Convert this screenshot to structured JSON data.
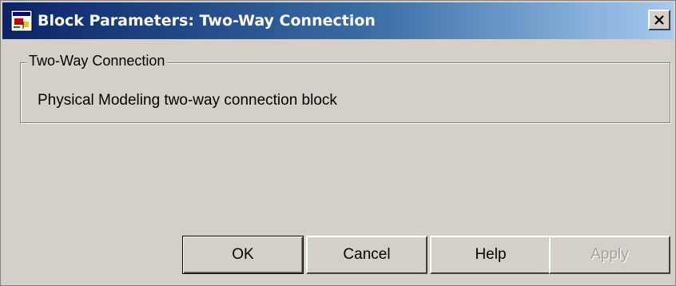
{
  "window": {
    "title": "Block Parameters: Two-Way Connection"
  },
  "group": {
    "legend": "Two-Way Connection",
    "description": "Physical Modeling two-way connection block"
  },
  "buttons": {
    "ok": "OK",
    "cancel": "Cancel",
    "help": "Help",
    "apply": "Apply"
  },
  "icons": {
    "app": "simulink-block-icon",
    "close": "close-icon"
  },
  "colors": {
    "titlebar_start": "#0a246a",
    "titlebar_end": "#a6caf0",
    "dialog_background": "#d4d0c8",
    "disabled_text": "#a0a0a0"
  },
  "state": {
    "apply_enabled": false,
    "default_button": "ok"
  }
}
